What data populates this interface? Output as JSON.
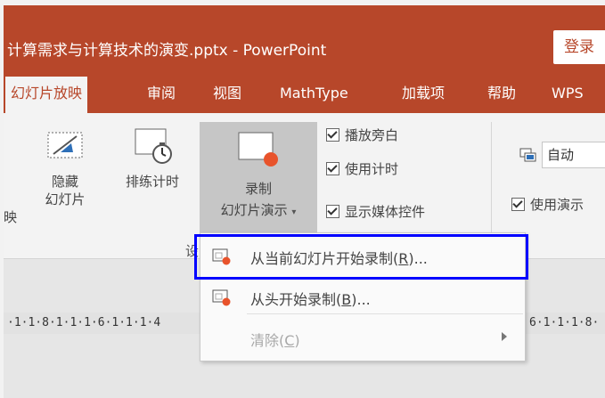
{
  "window": {
    "title": "计算需求与计算技术的演变.pptx  -  PowerPoint",
    "login_label": "登录"
  },
  "tabs": [
    {
      "label": "幻灯片放映",
      "active": true
    },
    {
      "label": "审阅"
    },
    {
      "label": "视图"
    },
    {
      "label": "MathType"
    },
    {
      "label": "加载项"
    },
    {
      "label": "帮助"
    },
    {
      "label": "WPS"
    }
  ],
  "ribbon": {
    "cut_label": "映",
    "hide_slide": {
      "line1": "隐藏",
      "line2": "幻灯片",
      "icon": "hide-slide-icon"
    },
    "rehearse": {
      "label": "排练计时",
      "icon": "stopwatch-icon"
    },
    "record": {
      "line1": "录制",
      "line2": "幻灯片演示",
      "icon": "record-icon"
    },
    "checkboxes": [
      {
        "label": "播放旁白",
        "checked": true
      },
      {
        "label": "使用计时",
        "checked": true
      },
      {
        "label": "显示媒体控件",
        "checked": true
      }
    ],
    "monitor": {
      "value": "自动",
      "icon": "monitor-icon"
    },
    "presenter_view": {
      "label": "使用演示",
      "checked": true
    },
    "group_label_fragment": "设"
  },
  "ruler": {
    "left_text": "·1·1·8·1·1·1·6·1·1·1·4",
    "right_text": "6·1·1·1·8·"
  },
  "menu": {
    "items": [
      {
        "label_pre": "从当前幻灯片开始录制(",
        "accel": "R",
        "label_post": ")...",
        "icon": "record-from-current-icon",
        "enabled": true
      },
      {
        "label_pre": "从头开始录制(",
        "accel": "B",
        "label_post": ")...",
        "icon": "record-from-beginning-icon",
        "enabled": true
      },
      {
        "label_pre": "清除(",
        "accel": "C",
        "label_post": ")",
        "enabled": false,
        "has_submenu": true
      }
    ]
  },
  "colors": {
    "accent": "#b7472a",
    "highlight_border": "#0000ff"
  }
}
